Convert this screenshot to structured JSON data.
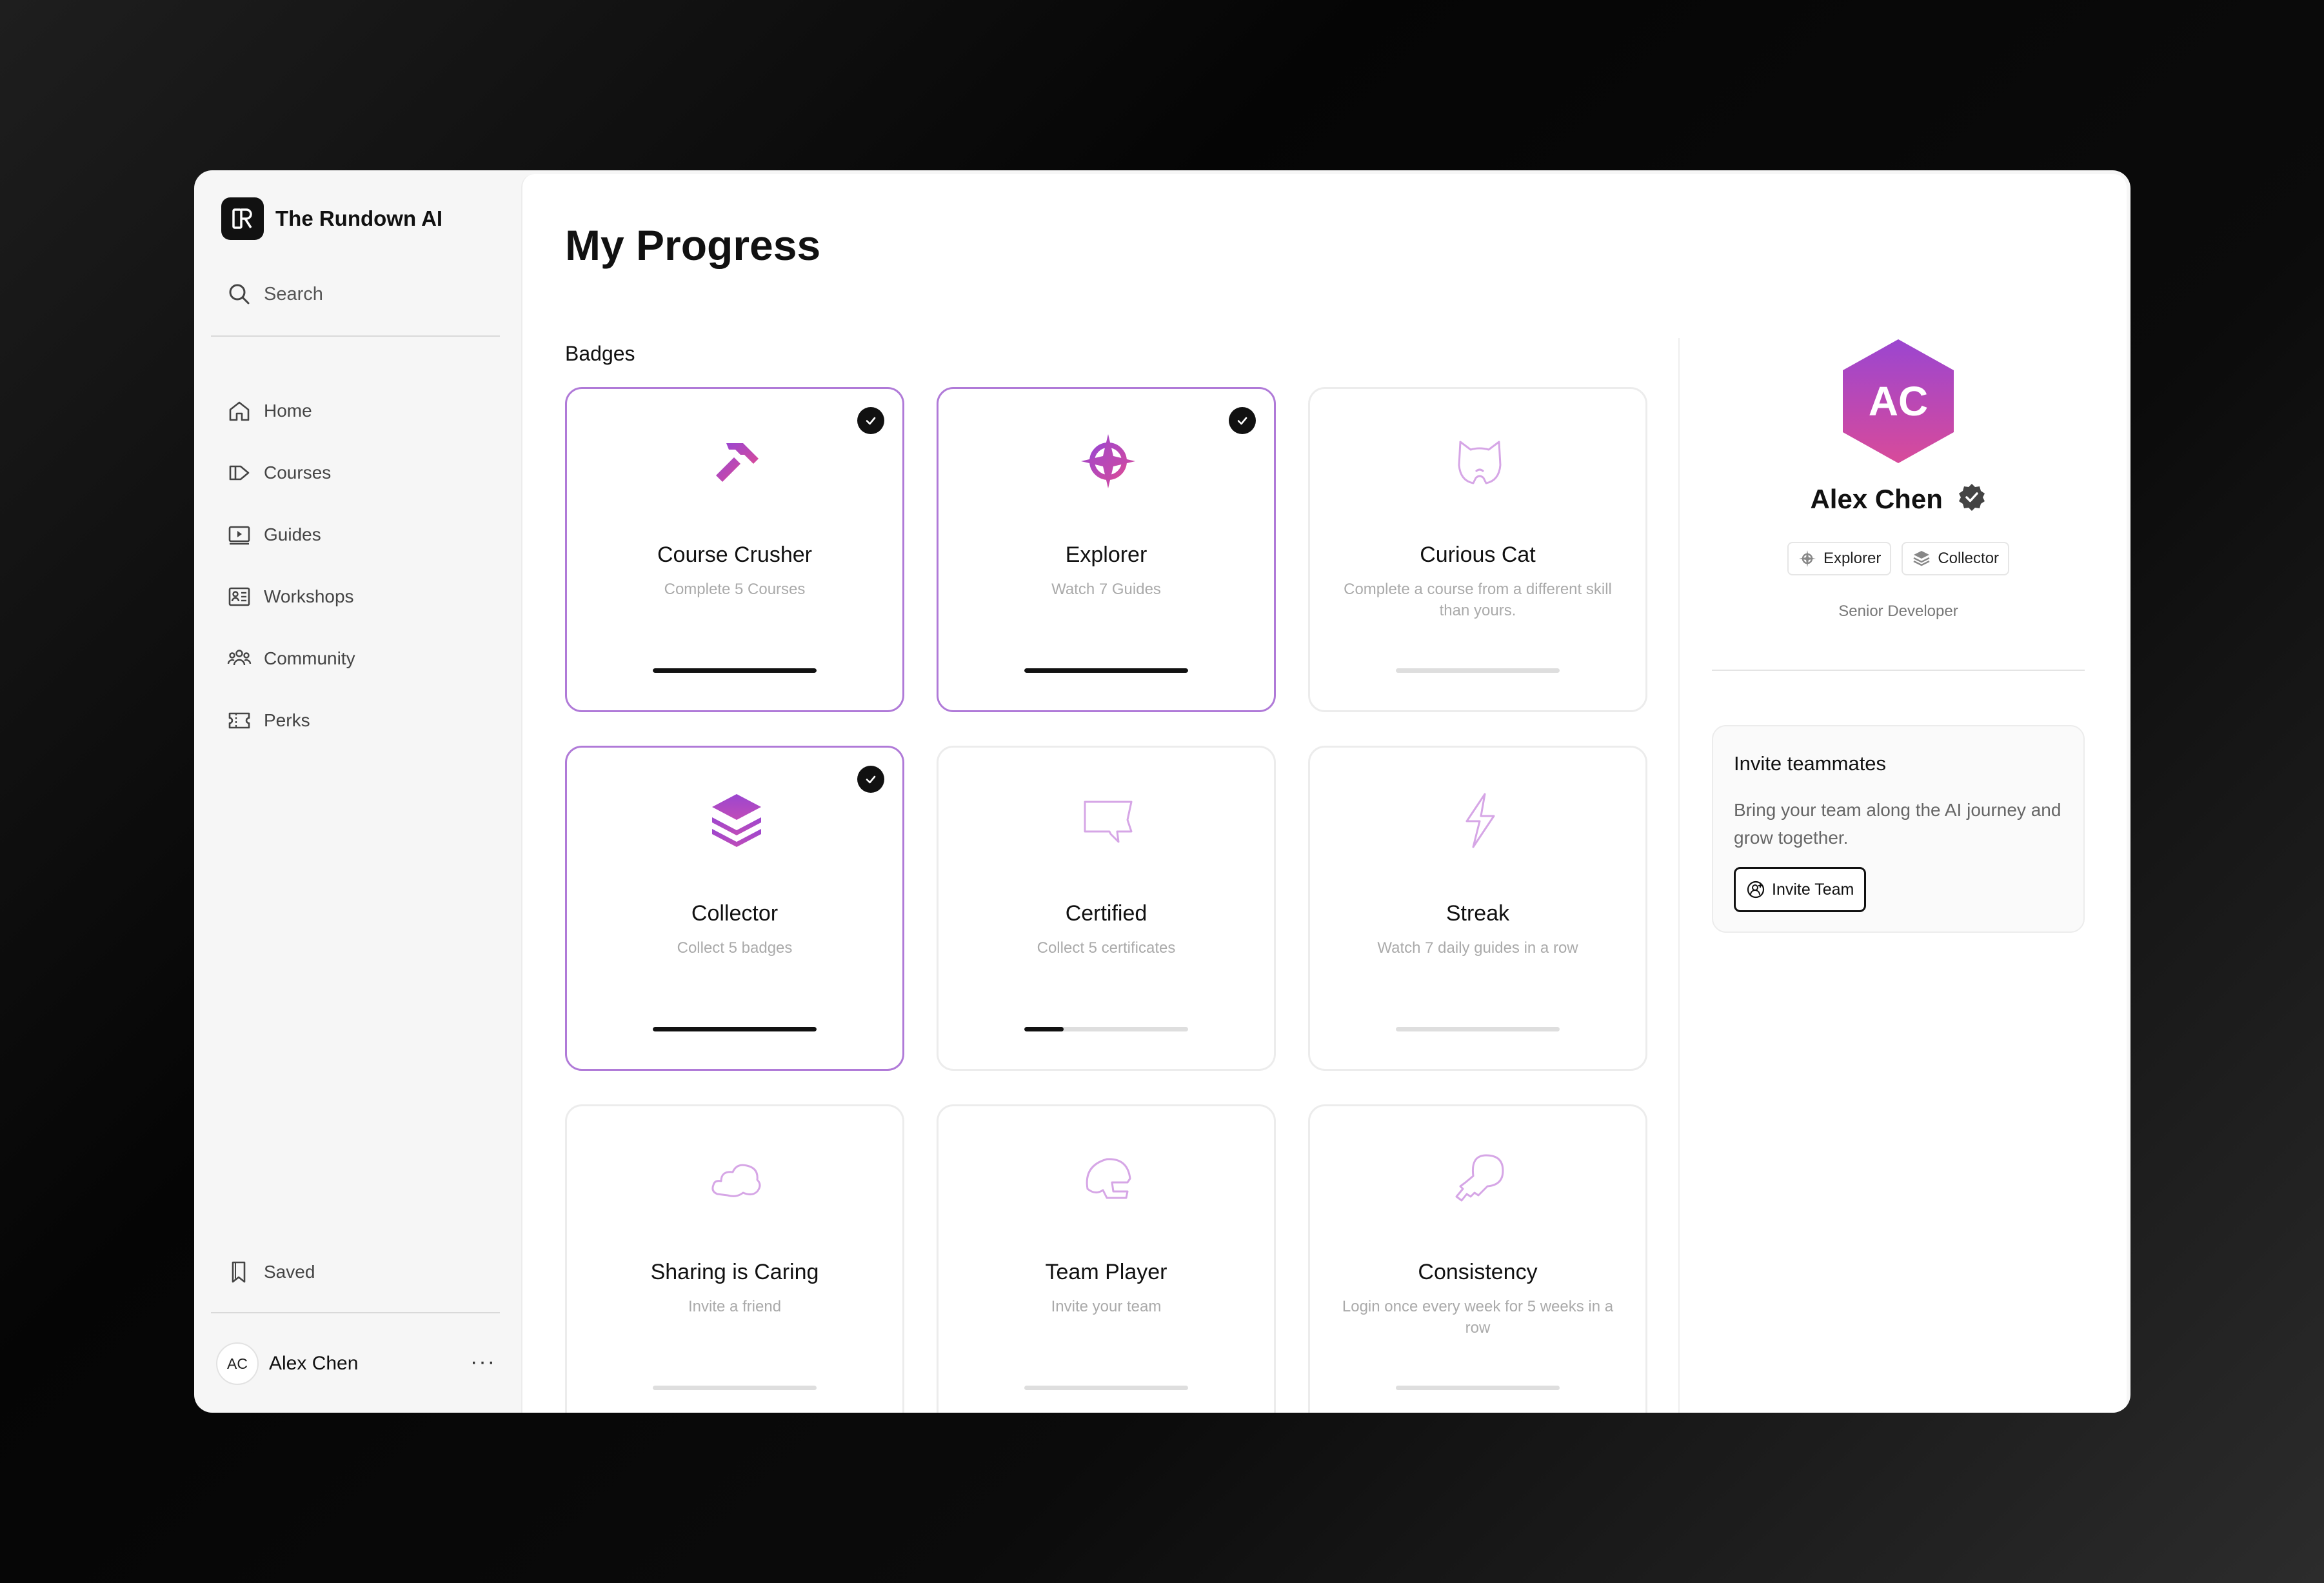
{
  "app": {
    "name": "The Rundown AI"
  },
  "sidebar": {
    "search_label": "Search",
    "items": [
      {
        "label": "Home",
        "icon": "home-icon"
      },
      {
        "label": "Courses",
        "icon": "courses-icon"
      },
      {
        "label": "Guides",
        "icon": "guides-icon"
      },
      {
        "label": "Workshops",
        "icon": "workshops-icon"
      },
      {
        "label": "Community",
        "icon": "community-icon"
      },
      {
        "label": "Perks",
        "icon": "perks-icon"
      }
    ],
    "saved_label": "Saved",
    "user": {
      "initials": "AC",
      "name": "Alex Chen",
      "more": "···"
    }
  },
  "main": {
    "title": "My Progress",
    "badges_label": "Badges",
    "badges": [
      {
        "name": "Course Crusher",
        "desc": "Complete 5 Courses",
        "icon": "hammer-icon",
        "earned": true,
        "progress": 1.0
      },
      {
        "name": "Explorer",
        "desc": "Watch 7 Guides",
        "icon": "compass-icon",
        "earned": true,
        "progress": 1.0
      },
      {
        "name": "Curious Cat",
        "desc": "Complete a course from a different skill than yours.",
        "icon": "cat-icon",
        "earned": false,
        "progress": 0
      },
      {
        "name": "Collector",
        "desc": "Collect 5 badges",
        "icon": "layers-icon",
        "earned": true,
        "progress": 1.0
      },
      {
        "name": "Certified",
        "desc": "Collect 5 certificates",
        "icon": "certificate-icon",
        "earned": false,
        "progress": 0.24
      },
      {
        "name": "Streak",
        "desc": "Watch 7 daily guides in a row",
        "icon": "lightning-icon",
        "earned": false,
        "progress": 0
      },
      {
        "name": "Sharing is Caring",
        "desc": "Invite a friend",
        "icon": "cloud-icon",
        "earned": false,
        "progress": 0
      },
      {
        "name": "Team Player",
        "desc": "Invite your team",
        "icon": "helmet-icon",
        "earned": false,
        "progress": 0
      },
      {
        "name": "Consistency",
        "desc": "Login once every week for 5 weeks in a row",
        "icon": "key-icon",
        "earned": false,
        "progress": 0
      }
    ]
  },
  "profile": {
    "initials": "AC",
    "name": "Alex Chen",
    "chips": [
      "Explorer",
      "Collector"
    ],
    "role": "Senior Developer"
  },
  "invite": {
    "title": "Invite teammates",
    "text": "Bring your team along the AI journey and grow together.",
    "button": "Invite Team"
  },
  "colors": {
    "accent": "#9b46d0",
    "accent_pink": "#d84a9a",
    "earned_border": "#b07ad8"
  }
}
